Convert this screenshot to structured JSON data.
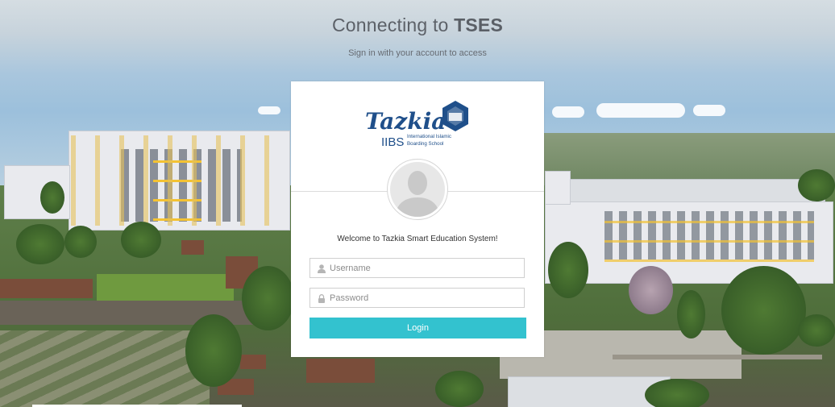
{
  "header": {
    "title_prefix": "Connecting to",
    "title_app": "TSES",
    "subtitle": "Sign in with your account to access"
  },
  "logo": {
    "wordmark": "Tazkia",
    "abbr": "IIBS",
    "tagline_line1": "International Islamic",
    "tagline_line2": "Boarding School"
  },
  "login": {
    "welcome": "Welcome to Tazkia Smart Education System!",
    "username_placeholder": "Username",
    "password_placeholder": "Password",
    "button_label": "Login",
    "button_color": "#33c2cf"
  },
  "icons": {
    "username": "user-icon",
    "password": "lock-icon",
    "avatar": "default-avatar"
  }
}
